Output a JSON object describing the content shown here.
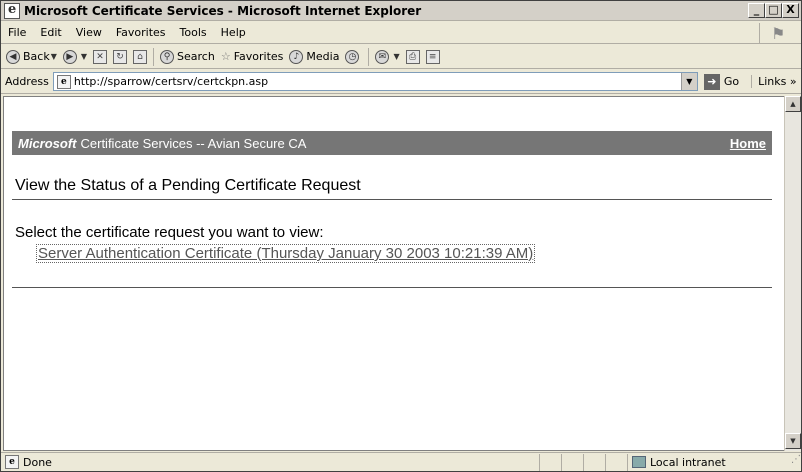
{
  "window": {
    "title": "Microsoft Certificate Services - Microsoft Internet Explorer",
    "controls": {
      "minimize": "_",
      "maximize": "□",
      "close": "X"
    }
  },
  "menubar": {
    "items": [
      "File",
      "Edit",
      "View",
      "Favorites",
      "Tools",
      "Help"
    ]
  },
  "toolbar": {
    "back_label": "Back",
    "search_label": "Search",
    "favorites_label": "Favorites",
    "media_label": "Media"
  },
  "address": {
    "label": "Address",
    "url": "http://sparrow/certsrv/certckpn.asp",
    "go_label": "Go",
    "links_label": "Links »"
  },
  "page": {
    "banner_brand": "Microsoft",
    "banner_title": "Certificate Services  --  Avian Secure CA",
    "home_link": "Home",
    "title": "View the Status of a Pending Certificate Request",
    "prompt": "Select the certificate request you want to view:",
    "request_link": "Server Authentication Certificate (Thursday January 30 2003 10:21:39 AM)"
  },
  "status": {
    "text": "Done",
    "zone": "Local intranet"
  },
  "icons": {
    "back": "back-arrow-icon",
    "forward": "forward-arrow-icon",
    "stop": "stop-icon",
    "refresh": "refresh-icon",
    "home": "home-icon",
    "search": "search-icon",
    "favorites": "favorites-star-icon",
    "media": "media-icon",
    "history": "history-icon",
    "mail": "mail-icon",
    "print": "print-icon",
    "edit": "edit-icon"
  }
}
